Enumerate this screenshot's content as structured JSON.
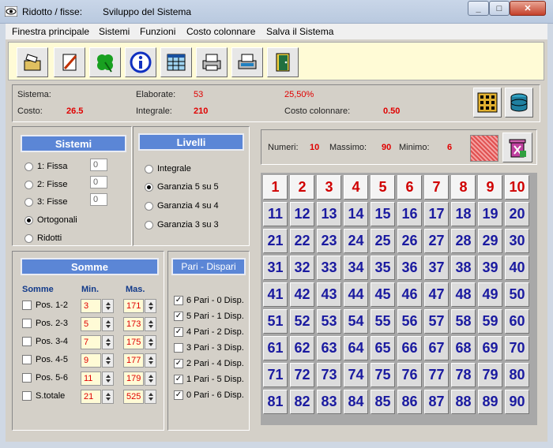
{
  "window": {
    "title": "Ridotto / fisse:",
    "subtitle": "Sviluppo del Sistema",
    "min": "_",
    "max": "□",
    "close": "✕"
  },
  "menu": [
    "Finestra principale",
    "Sistemi",
    "Funzioni",
    "Costo colonnare",
    "Salva il Sistema"
  ],
  "toolbar": [
    "open-folder-icon",
    "edit-pencil-icon",
    "clover-icon",
    "info-icon",
    "calculator-sheet-icon",
    "printer-icon",
    "print-preview-icon",
    "exit-door-icon"
  ],
  "info": {
    "sistema_label": "Sistema:",
    "costo_label": "Costo:",
    "costo_value": "26.5",
    "elaborate_label": "Elaborate:",
    "elaborate_value": "53",
    "integrale_label": "Integrale:",
    "integrale_value": "210",
    "percent": "25,50%",
    "costo_colonnare_label": "Costo colonnare:",
    "costo_colonnare_value": "0.50"
  },
  "sistemi": {
    "header": "Sistemi",
    "options": [
      {
        "label": "1: Fissa",
        "value": "0",
        "selected": false
      },
      {
        "label": "2: Fisse",
        "value": "0",
        "selected": false
      },
      {
        "label": "3: Fisse",
        "value": "0",
        "selected": false
      },
      {
        "label": "Ortogonali",
        "selected": true
      },
      {
        "label": "Ridotti",
        "selected": false
      }
    ]
  },
  "livelli": {
    "header": "Livelli",
    "options": [
      {
        "label": "Integrale",
        "selected": false
      },
      {
        "label": "Garanzia 5 su 5",
        "selected": true
      },
      {
        "label": "Garanzia 4 su 4",
        "selected": false
      },
      {
        "label": "Garanzia 3 su 3",
        "selected": false
      }
    ]
  },
  "somme": {
    "header": "Somme",
    "col_label": "Somme",
    "min_label": "Min.",
    "max_label": "Mas.",
    "rows": [
      {
        "label": "Pos. 1-2",
        "min": "3",
        "max": "171"
      },
      {
        "label": "Pos. 2-3",
        "min": "5",
        "max": "173"
      },
      {
        "label": "Pos. 3-4",
        "min": "7",
        "max": "175"
      },
      {
        "label": "Pos. 4-5",
        "min": "9",
        "max": "177"
      },
      {
        "label": "Pos. 5-6",
        "min": "11",
        "max": "179"
      },
      {
        "label": "S.totale",
        "min": "21",
        "max": "525"
      }
    ]
  },
  "pari": {
    "header": "Pari - Dispari",
    "rows": [
      {
        "label": "6 Pari - 0 Disp.",
        "checked": true
      },
      {
        "label": "5 Pari - 1 Disp.",
        "checked": true
      },
      {
        "label": "4 Pari - 2 Disp.",
        "checked": true
      },
      {
        "label": "3 Pari - 3 Disp.",
        "checked": false
      },
      {
        "label": "2 Pari - 4 Disp.",
        "checked": true
      },
      {
        "label": "1 Pari - 5 Disp.",
        "checked": true
      },
      {
        "label": "0 Pari - 6 Disp.",
        "checked": true
      }
    ]
  },
  "numeri": {
    "numeri_label": "Numeri:",
    "numeri_value": "10",
    "massimo_label": "Massimo:",
    "massimo_value": "90",
    "minimo_label": "Minimo:",
    "minimo_value": "6"
  },
  "grid_numbers": [
    1,
    2,
    3,
    4,
    5,
    6,
    7,
    8,
    9,
    10,
    11,
    12,
    13,
    14,
    15,
    16,
    17,
    18,
    19,
    20,
    21,
    22,
    23,
    24,
    25,
    26,
    27,
    28,
    29,
    30,
    31,
    32,
    33,
    34,
    35,
    36,
    37,
    38,
    39,
    40,
    41,
    42,
    43,
    44,
    45,
    46,
    47,
    48,
    49,
    50,
    51,
    52,
    53,
    54,
    55,
    56,
    57,
    58,
    59,
    60,
    61,
    62,
    63,
    64,
    65,
    66,
    67,
    68,
    69,
    70,
    71,
    72,
    73,
    74,
    75,
    76,
    77,
    78,
    79,
    80,
    81,
    82,
    83,
    84,
    85,
    86,
    87,
    88,
    89,
    90
  ],
  "selected_numbers": [
    1,
    2,
    3,
    4,
    5,
    6,
    7,
    8,
    9,
    10
  ],
  "colors": {
    "accent_header": "#5b86d6",
    "value_red": "#e00000",
    "grid_number": "#1a1aa0"
  }
}
